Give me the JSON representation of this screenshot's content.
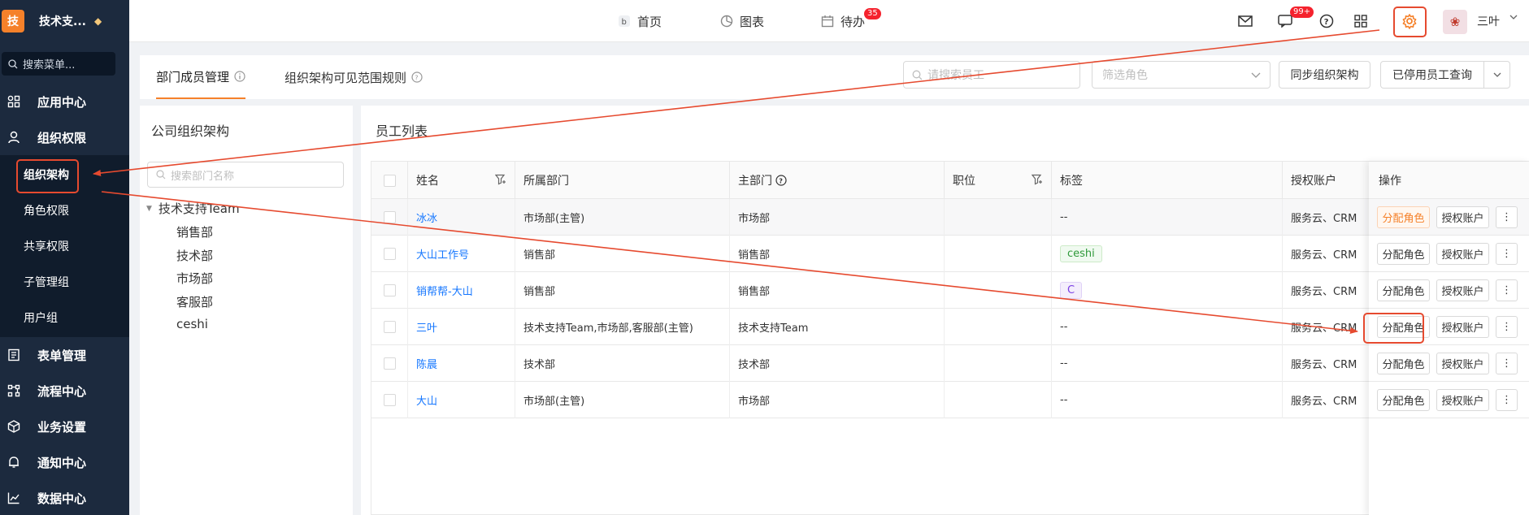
{
  "colors": {
    "sidebar_bg": "#1c2a3e",
    "accent": "#f5812a",
    "link": "#1677ff",
    "annotation": "#e64a2f"
  },
  "sidebar": {
    "logo_text": "技",
    "brand_name": "技术支...",
    "search_placeholder": "搜索菜单...",
    "items": [
      {
        "label": "应用中心",
        "icon": "apps-icon"
      },
      {
        "label": "组织权限",
        "icon": "user-icon"
      },
      {
        "label": "表单管理",
        "icon": "form-icon"
      },
      {
        "label": "流程中心",
        "icon": "flow-icon"
      },
      {
        "label": "业务设置",
        "icon": "cube-icon"
      },
      {
        "label": "通知中心",
        "icon": "bell-icon"
      },
      {
        "label": "数据中心",
        "icon": "chart-icon"
      }
    ],
    "sub_items": [
      "组织架构",
      "角色权限",
      "共享权限",
      "子管理组",
      "用户组"
    ]
  },
  "topbar": {
    "nav": [
      {
        "label": "首页",
        "icon": "home-icon"
      },
      {
        "label": "图表",
        "icon": "pie-icon"
      },
      {
        "label": "待办",
        "icon": "calendar-icon",
        "badge": "35"
      }
    ],
    "chat_badge": "99+",
    "user_name": "三叶"
  },
  "tabs": {
    "items": [
      "部门成员管理",
      "组织架构可见范围规则"
    ],
    "employee_search_placeholder": "请搜索员工",
    "role_filter_placeholder": "筛选角色",
    "sync_button": "同步组织架构",
    "disabled_query_button": "已停用员工查询"
  },
  "org_panel": {
    "title": "公司组织架构",
    "search_placeholder": "搜索部门名称",
    "root": "技术支持Team",
    "children": [
      "销售部",
      "技术部",
      "市场部",
      "客服部",
      "ceshi"
    ]
  },
  "employee_panel": {
    "title": "员工列表",
    "columns": [
      "姓名",
      "所属部门",
      "主部门",
      "职位",
      "标签",
      "授权账户",
      "操作"
    ],
    "rows": [
      {
        "name": "冰冰",
        "dept": "市场部(主管)",
        "main_dept": "市场部",
        "position": "",
        "tag": "--",
        "account": "服务云、CRM"
      },
      {
        "name": "大山工作号",
        "dept": "销售部",
        "main_dept": "销售部",
        "position": "",
        "tag": "ceshi",
        "account": "服务云、CRM"
      },
      {
        "name": "销帮帮-大山",
        "dept": "销售部",
        "main_dept": "销售部",
        "position": "",
        "tag": "C",
        "account": "服务云、CRM"
      },
      {
        "name": "三叶",
        "dept": "技术支持Team,市场部,客服部(主管)",
        "main_dept": "技术支持Team",
        "position": "",
        "tag": "--",
        "account": "服务云、CRM"
      },
      {
        "name": "陈晨",
        "dept": "技术部",
        "main_dept": "技术部",
        "position": "",
        "tag": "--",
        "account": "服务云、CRM"
      },
      {
        "name": "大山",
        "dept": "市场部(主管)",
        "main_dept": "市场部",
        "position": "",
        "tag": "--",
        "account": "服务云、CRM"
      }
    ],
    "actions": {
      "assign_role": "分配角色",
      "authorize": "授权账户",
      "more": "⋮"
    }
  }
}
